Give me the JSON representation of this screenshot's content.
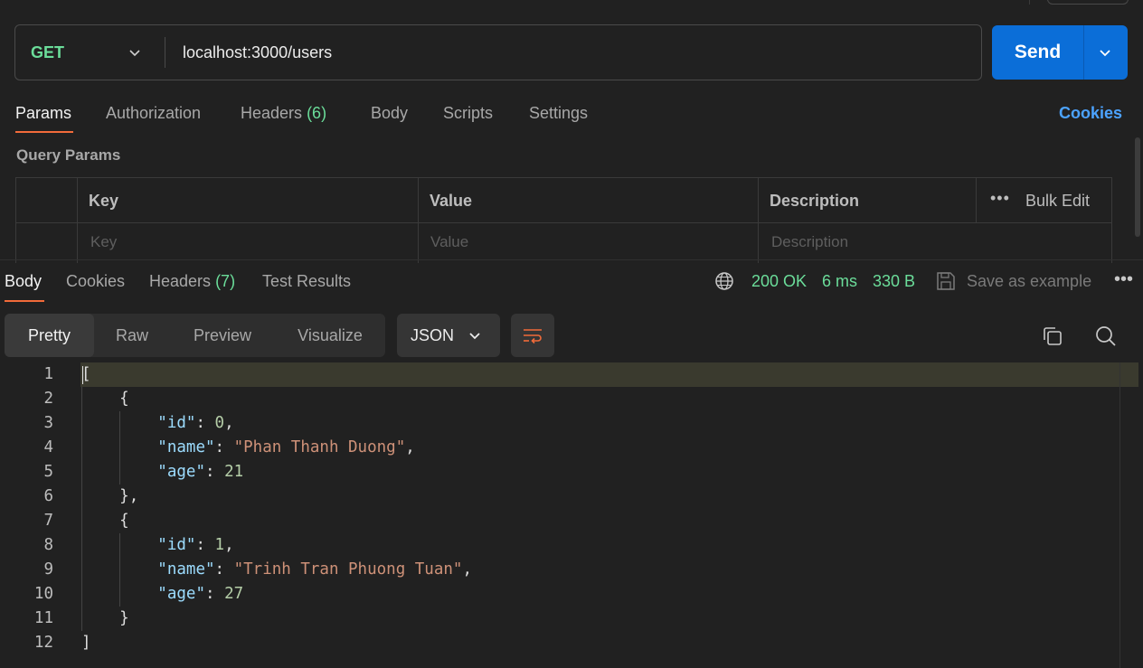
{
  "request": {
    "method": "GET",
    "url": "localhost:3000/users",
    "send_label": "Send"
  },
  "request_tabs": {
    "params": "Params",
    "authorization": "Authorization",
    "headers_label": "Headers",
    "headers_count": "(6)",
    "body": "Body",
    "scripts": "Scripts",
    "settings": "Settings",
    "cookies": "Cookies"
  },
  "query_params": {
    "title": "Query Params",
    "columns": [
      "Key",
      "Value",
      "Description"
    ],
    "bulk_edit": "Bulk Edit",
    "placeholders": {
      "key": "Key",
      "value": "Value",
      "description": "Description"
    }
  },
  "response_tabs": {
    "body": "Body",
    "cookies": "Cookies",
    "headers_label": "Headers",
    "headers_count": "(7)",
    "test_results": "Test Results"
  },
  "response_status": {
    "status": "200 OK",
    "time": "6 ms",
    "size": "330 B",
    "save_example": "Save as example"
  },
  "view_modes": [
    "Pretty",
    "Raw",
    "Preview",
    "Visualize"
  ],
  "format": "JSON",
  "code_lines": [
    {
      "n": "1",
      "indent": "",
      "parts": [
        [
          "p",
          "["
        ]
      ]
    },
    {
      "n": "2",
      "indent": "    ",
      "parts": [
        [
          "p",
          "{"
        ]
      ]
    },
    {
      "n": "3",
      "indent": "        ",
      "parts": [
        [
          "k",
          "\"id\""
        ],
        [
          "p",
          ": "
        ],
        [
          "n",
          "0"
        ],
        [
          "p",
          ","
        ]
      ]
    },
    {
      "n": "4",
      "indent": "        ",
      "parts": [
        [
          "k",
          "\"name\""
        ],
        [
          "p",
          ": "
        ],
        [
          "s",
          "\"Phan Thanh Duong\""
        ],
        [
          "p",
          ","
        ]
      ]
    },
    {
      "n": "5",
      "indent": "        ",
      "parts": [
        [
          "k",
          "\"age\""
        ],
        [
          "p",
          ": "
        ],
        [
          "n",
          "21"
        ]
      ]
    },
    {
      "n": "6",
      "indent": "    ",
      "parts": [
        [
          "p",
          "},"
        ]
      ]
    },
    {
      "n": "7",
      "indent": "    ",
      "parts": [
        [
          "p",
          "{"
        ]
      ]
    },
    {
      "n": "8",
      "indent": "        ",
      "parts": [
        [
          "k",
          "\"id\""
        ],
        [
          "p",
          ": "
        ],
        [
          "n",
          "1"
        ],
        [
          "p",
          ","
        ]
      ]
    },
    {
      "n": "9",
      "indent": "        ",
      "parts": [
        [
          "k",
          "\"name\""
        ],
        [
          "p",
          ": "
        ],
        [
          "s",
          "\"Trinh Tran Phuong Tuan\""
        ],
        [
          "p",
          ","
        ]
      ]
    },
    {
      "n": "10",
      "indent": "        ",
      "parts": [
        [
          "k",
          "\"age\""
        ],
        [
          "p",
          ": "
        ],
        [
          "n",
          "27"
        ]
      ]
    },
    {
      "n": "11",
      "indent": "    ",
      "parts": [
        [
          "p",
          "}"
        ]
      ]
    },
    {
      "n": "12",
      "indent": "",
      "parts": [
        [
          "p",
          "]"
        ]
      ]
    }
  ],
  "colors": {
    "accent": "#f26b3a",
    "send_button": "#0b6ed8",
    "status_green": "#6bdd9a",
    "link_blue": "#4ca3ff"
  },
  "icons": [
    "chevron-down-icon",
    "globe-icon",
    "save-icon",
    "more-icon",
    "wrap-lines-icon",
    "copy-icon",
    "search-icon"
  ]
}
